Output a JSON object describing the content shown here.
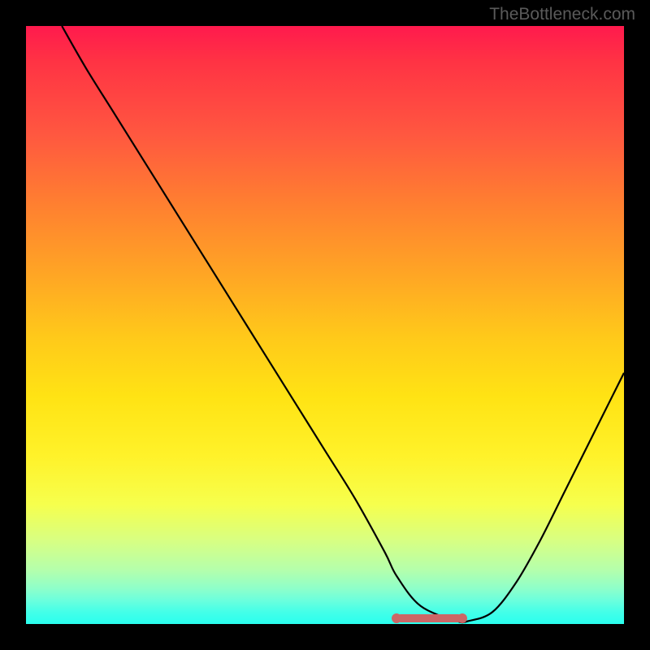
{
  "watermark": "TheBottleneck.com",
  "chart_data": {
    "type": "line",
    "title": "",
    "xlabel": "",
    "ylabel": "",
    "xlim": [
      0,
      100
    ],
    "ylim": [
      0,
      100
    ],
    "grid": false,
    "series": [
      {
        "name": "curve",
        "x": [
          6,
          10,
          15,
          20,
          25,
          30,
          35,
          40,
          45,
          50,
          55,
          60,
          62,
          66,
          72,
          74,
          78,
          82,
          86,
          90,
          94,
          98,
          100
        ],
        "y": [
          100,
          93,
          85,
          77,
          69,
          61,
          53,
          45,
          37,
          29,
          21,
          12,
          8,
          3,
          0.5,
          0.5,
          2,
          7,
          14,
          22,
          30,
          38,
          42
        ]
      }
    ],
    "markers": [
      {
        "x": 62,
        "y": 1,
        "color": "#cc6666"
      },
      {
        "x": 73,
        "y": 1,
        "color": "#cc6666"
      }
    ],
    "plateau": {
      "x_start": 62,
      "x_end": 73,
      "y": 1,
      "color": "#cc6666"
    },
    "line_color": "#000000",
    "background_gradient": [
      "#ff1a4d",
      "#ffe314",
      "#2affef"
    ]
  }
}
